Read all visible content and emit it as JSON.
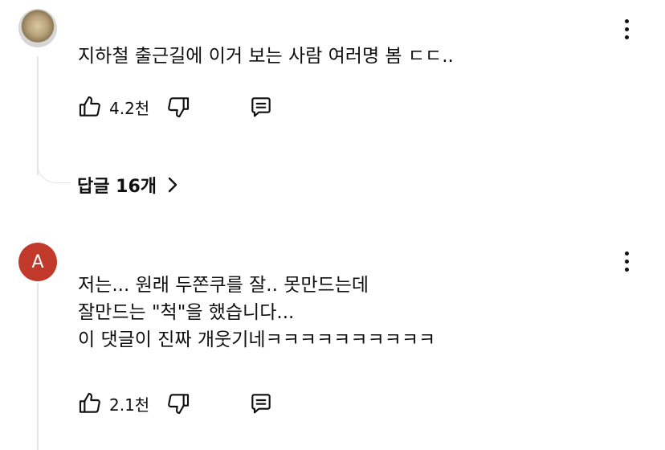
{
  "comments": [
    {
      "avatar": "photo",
      "text_lines": [
        "지하철 출근길에 이거 보는 사람 여러명 봄 ㄷㄷ.."
      ],
      "like_count": "4.2천",
      "replies_label": "답글 16개"
    },
    {
      "avatar_letter": "A",
      "avatar_color": "#c0392b",
      "text_lines": [
        "저는... 원래 두쫀쿠를 잘.. 못만드는데",
        "잘만드는 \"척\"을 했습니다...",
        "이 댓글이 진짜 개웃기네ㅋㅋㅋㅋㅋㅋㅋㅋㅋㅋ"
      ],
      "like_count": "2.1천"
    }
  ],
  "icons": [
    "more-vert-icon",
    "thumb-up-icon",
    "thumb-down-icon",
    "reply-comment-icon",
    "chevron-right-icon"
  ]
}
